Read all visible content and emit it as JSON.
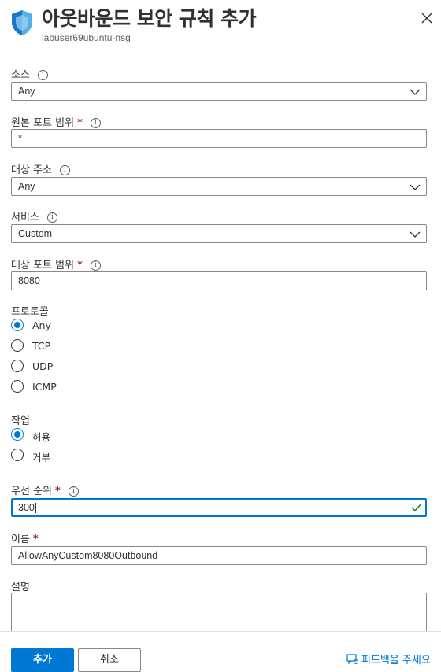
{
  "header": {
    "title": "아웃바운드 보안 규칙 추가",
    "subtitle": "labuser69ubuntu-nsg"
  },
  "source": {
    "label": "소스",
    "value": "Any"
  },
  "source_port": {
    "label": "원본 포트 범위",
    "value": "*"
  },
  "destination": {
    "label": "대상 주소",
    "value": "Any"
  },
  "service": {
    "label": "서비스",
    "value": "Custom"
  },
  "dest_port": {
    "label": "대상 포트 범위",
    "value": "8080"
  },
  "protocol": {
    "label": "프로토콜",
    "options": [
      "Any",
      "TCP",
      "UDP",
      "ICMP"
    ],
    "selected": "Any"
  },
  "action": {
    "label": "작업",
    "options": [
      "허용",
      "거부"
    ],
    "selected": "허용"
  },
  "priority": {
    "label": "우선 순위",
    "value": "300"
  },
  "name": {
    "label": "이름",
    "value": "AllowAnyCustom8080Outbound"
  },
  "description": {
    "label": "설명",
    "value": ""
  },
  "footer": {
    "add_label": "추가",
    "cancel_label": "취소",
    "feedback_label": "피드백을 주세요"
  },
  "required_marker": "*",
  "info_glyph": "i",
  "colors": {
    "accent": "#0078d4",
    "required": "#a4262c",
    "valid": "#107c10"
  },
  "icons": {
    "header": "shield-icon",
    "close": "close-icon",
    "dropdown": "chevron-down-icon",
    "valid": "checkmark-icon",
    "feedback": "feedback-icon"
  }
}
